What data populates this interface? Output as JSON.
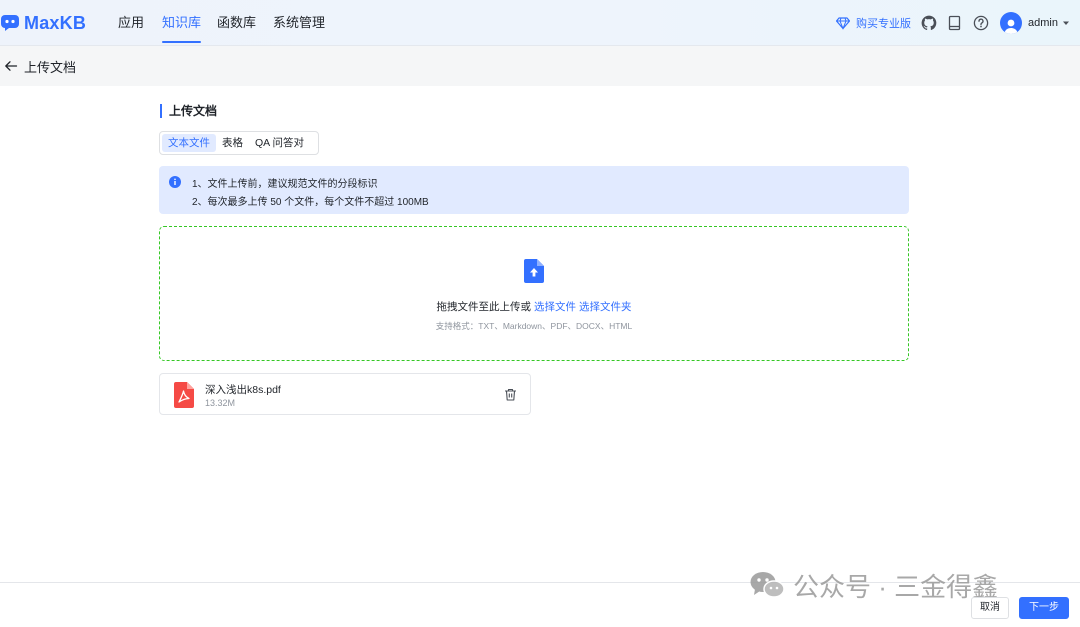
{
  "app": {
    "name": "MaxKB",
    "brand_color": "#3370ff"
  },
  "nav": {
    "items": [
      {
        "label": "应用"
      },
      {
        "label": "知识库",
        "active": true
      },
      {
        "label": "函数库"
      },
      {
        "label": "系统管理"
      }
    ]
  },
  "header_right": {
    "buy_pro": "购买专业版",
    "icons": [
      "diamond-icon",
      "github-icon",
      "document-icon",
      "help-icon"
    ],
    "username": "admin"
  },
  "page": {
    "title": "上传文档"
  },
  "upload": {
    "section_title": "上传文档",
    "tabs": [
      {
        "label": "文本文件",
        "active": true
      },
      {
        "label": "表格"
      },
      {
        "label": "QA 问答对"
      }
    ],
    "tips": [
      "1、文件上传前，建议规范文件的分段标识",
      "2、每次最多上传 50 个文件，每个文件不超过 100MB"
    ],
    "dropzone": {
      "prompt": "拖拽文件至此上传或",
      "select_file": "选择文件",
      "select_folder": "选择文件夹",
      "formats": "支持格式：TXT、Markdown、PDF、DOCX、HTML"
    },
    "files": [
      {
        "name": "深入浅出k8s.pdf",
        "size": "13.32M"
      }
    ]
  },
  "footer": {
    "cancel": "取消",
    "next": "下一步",
    "watermark": "公众号 · 三金得鑫"
  }
}
